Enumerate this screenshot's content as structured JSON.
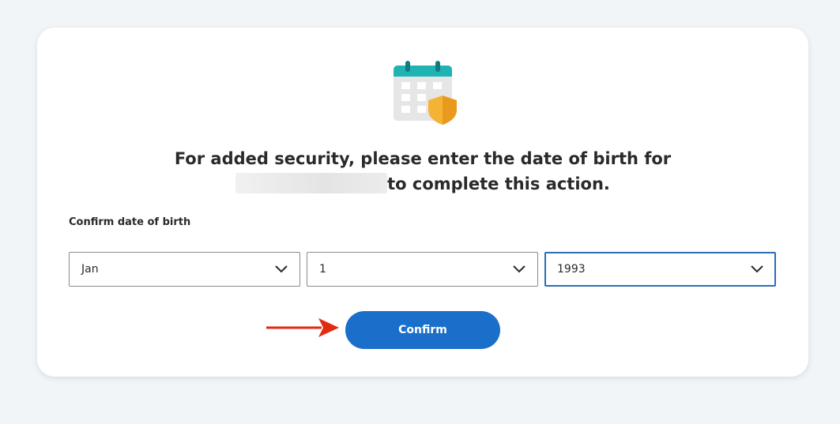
{
  "heading": {
    "line1": "For added security, please enter the date of birth for",
    "line2_suffix": "to complete this action."
  },
  "dob": {
    "label": "Confirm date of birth",
    "month": "Jan",
    "day": "1",
    "year": "1993"
  },
  "confirm_label": "Confirm",
  "colors": {
    "accent": "#1a6fcb",
    "calendar_header": "#1fb3b3",
    "shield": "#f5b335",
    "annotation_arrow": "#e02b12",
    "background": "#f2f5f8"
  },
  "icons": {
    "calendar": "calendar-shield-icon",
    "dropdown": "chevron-down-icon",
    "annotation": "red-arrow-icon"
  }
}
